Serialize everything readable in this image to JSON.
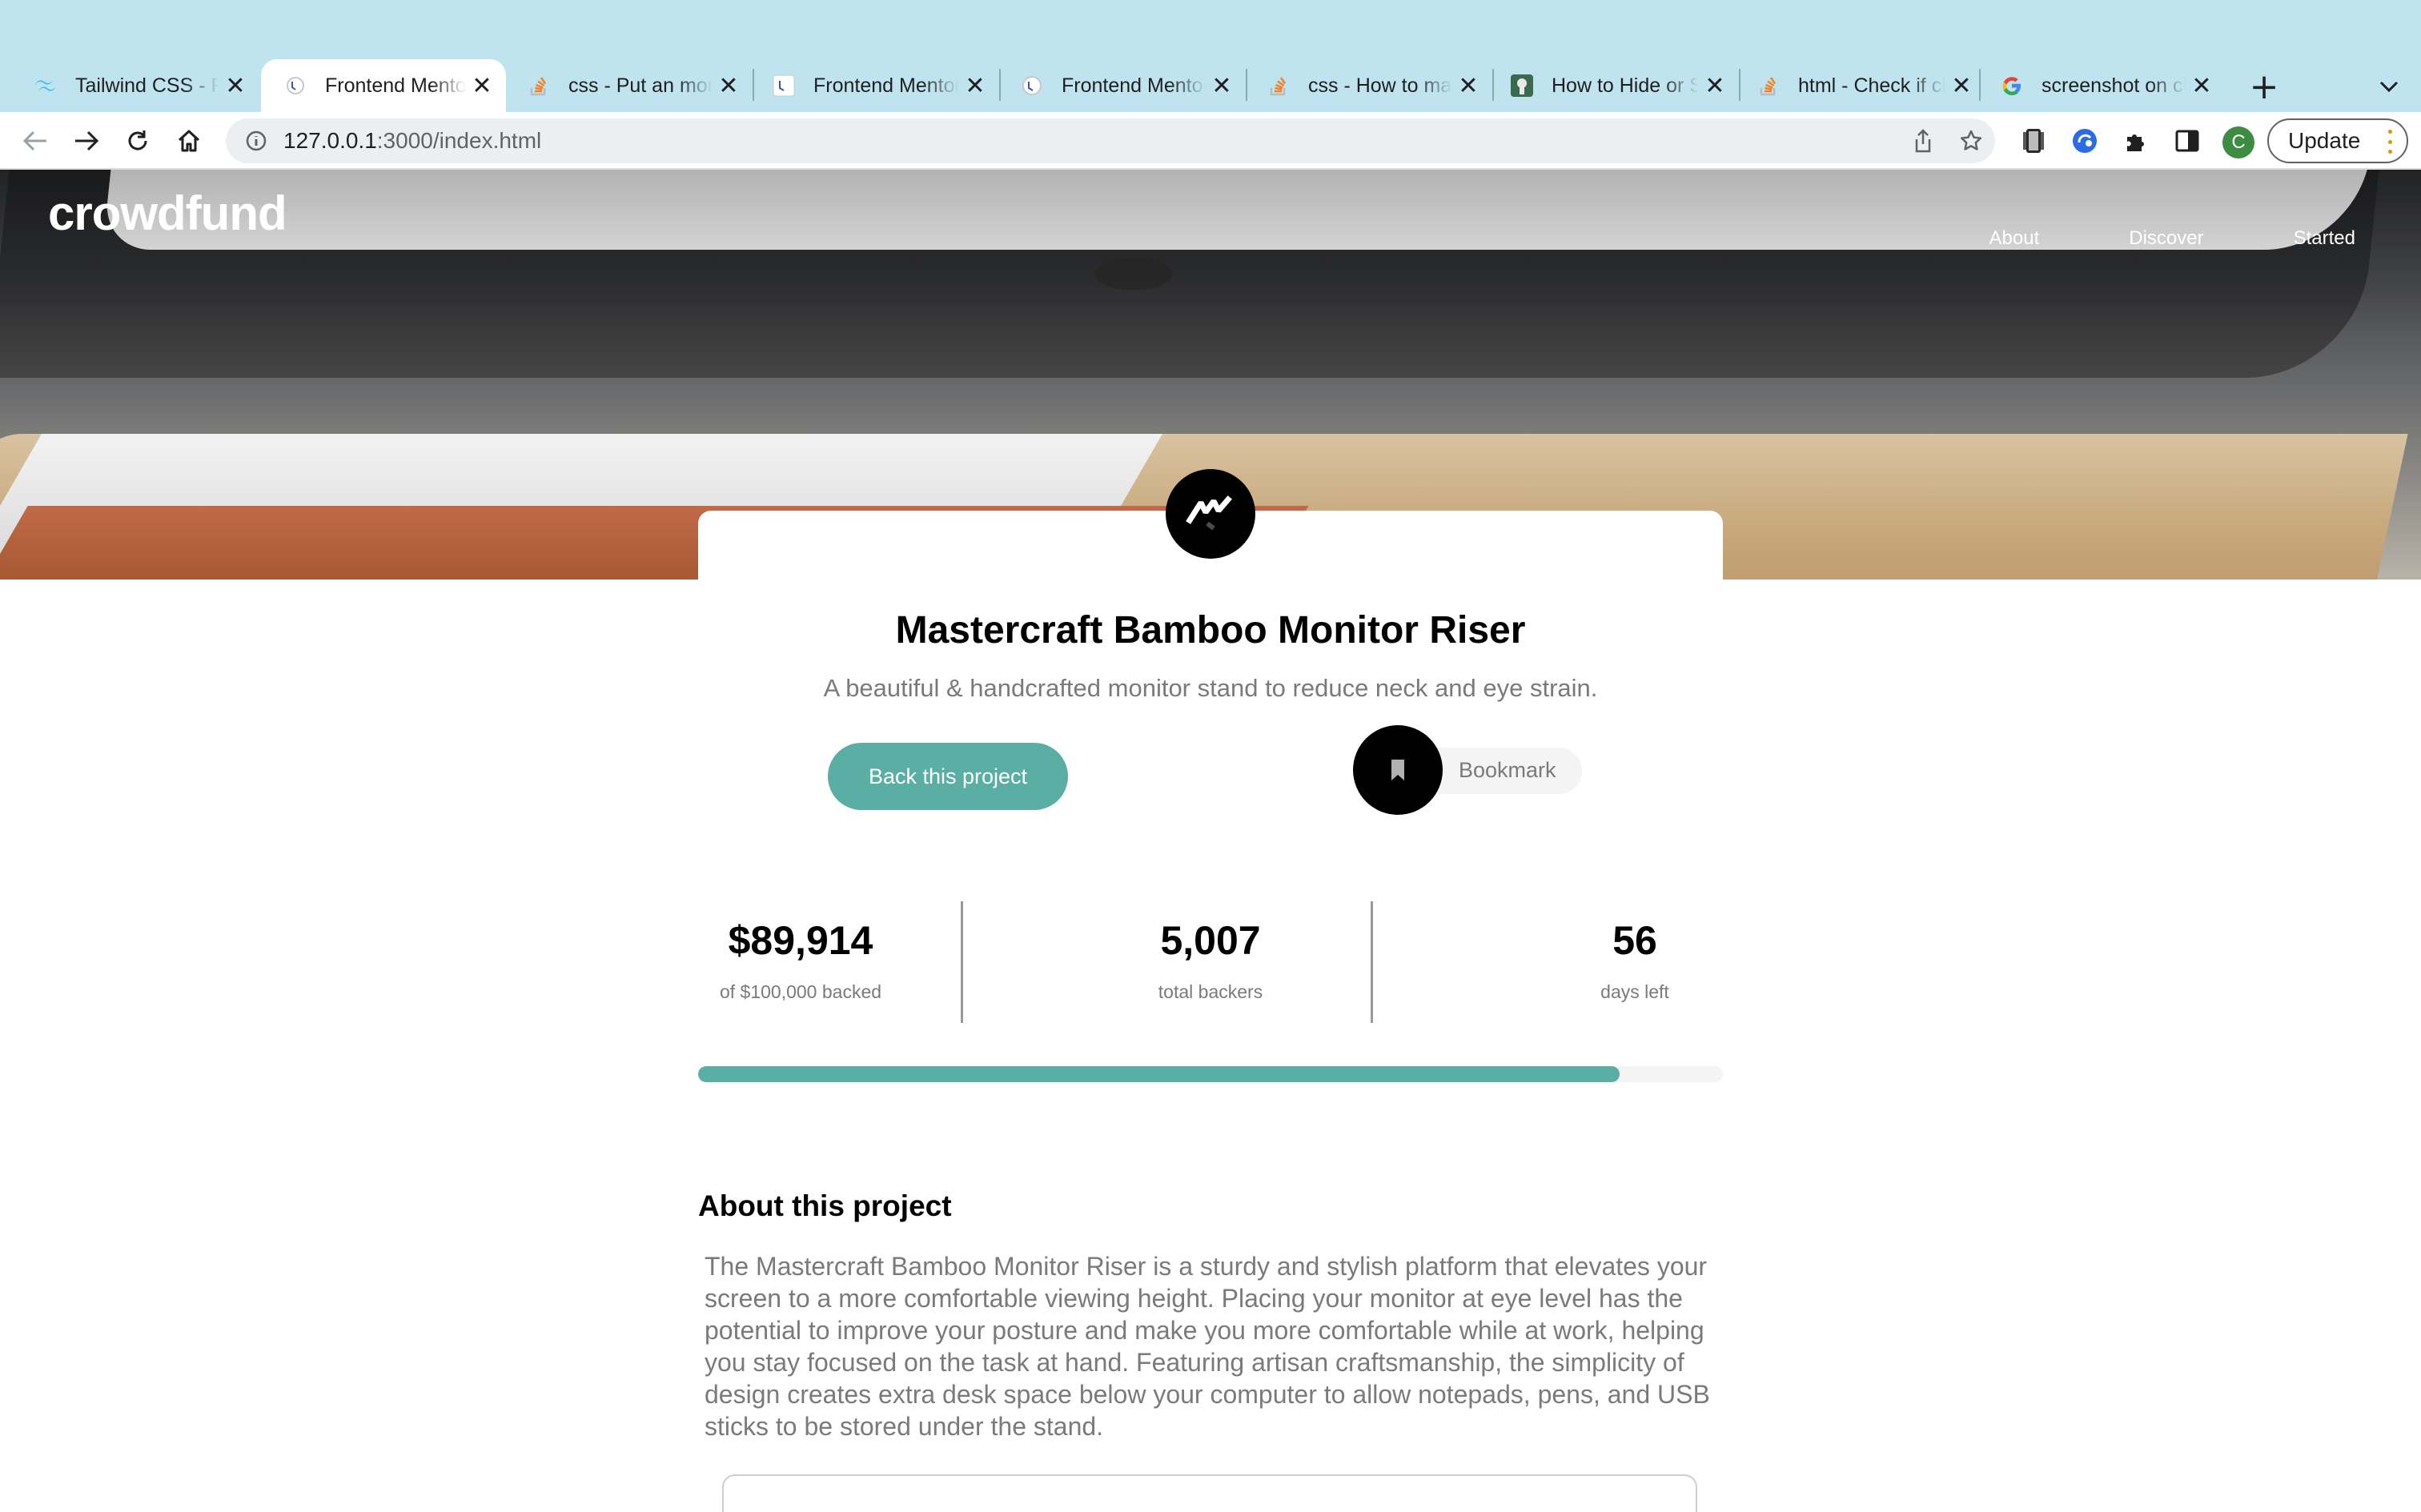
{
  "browser": {
    "tabs": [
      {
        "title": "Tailwind CSS - Rapidly build modern websites",
        "icon": "tailwind-icon",
        "active": false
      },
      {
        "title": "Frontend Mentor | Crowdfunding product page",
        "icon": "frontend-mentor-icon",
        "active": true
      },
      {
        "title": "css - Put an monitor image",
        "icon": "stackoverflow-icon",
        "active": false
      },
      {
        "title": "Frontend Mentor | Solutions",
        "icon": "frontend-mentor-icon",
        "active": false
      },
      {
        "title": "Frontend Mentor | Challenges",
        "icon": "frontend-mentor-icon",
        "active": false
      },
      {
        "title": "css - How to make a div",
        "icon": "stackoverflow-icon",
        "active": false
      },
      {
        "title": "How to Hide or Show Elements",
        "icon": "generic-site-icon",
        "active": false
      },
      {
        "title": "html - Check if checkbox",
        "icon": "stackoverflow-icon",
        "active": false
      },
      {
        "title": "screenshot on chrome",
        "icon": "google-icon",
        "active": false
      }
    ],
    "url_host": "127.0.0.1",
    "url_rest": ":3000/index.html",
    "update_label": "Update",
    "profile_initial": "C"
  },
  "site": {
    "logo": "crowdfund",
    "nav": [
      "About",
      "Discover",
      "Started"
    ]
  },
  "project": {
    "title": "Mastercraft Bamboo Monitor Riser",
    "subtitle": "A beautiful & handcrafted monitor stand to reduce neck and eye strain.",
    "back_label": "Back this project",
    "bookmark_label": "Bookmark",
    "accent_color": "#5aaea4"
  },
  "stats": [
    {
      "value": "$89,914",
      "label": "of $100,000 backed"
    },
    {
      "value": "5,007",
      "label": "total backers"
    },
    {
      "value": "56",
      "label": "days left"
    }
  ],
  "progress": {
    "percent": 89.914
  },
  "about": {
    "title": "About this project",
    "text": "The Mastercraft Bamboo Monitor Riser is a sturdy and stylish platform that elevates your screen to a more comfortable viewing height. Placing your monitor at eye level has the potential to improve your posture and make you more comfortable while at work, helping you stay focused on the task at hand. Featuring artisan craftsmanship, the simplicity of design creates extra desk space below your computer to allow notepads, pens, and USB sticks to be stored under the stand."
  }
}
